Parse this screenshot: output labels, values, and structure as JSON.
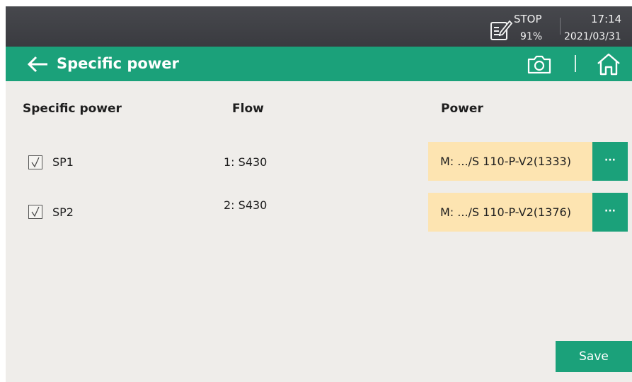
{
  "status_bar": {
    "state": "STOP",
    "percent": "91%",
    "time": "17:14",
    "date": "2021/03/31",
    "doc_icon": "document-edit-icon"
  },
  "header": {
    "title": "Specific power",
    "back_icon": "arrow-left-icon",
    "camera_icon": "camera-icon",
    "home_icon": "home-icon"
  },
  "columns": {
    "specific_power": "Specific power",
    "flow": "Flow",
    "power": "Power"
  },
  "rows": [
    {
      "checked": true,
      "label": "SP1",
      "flow": "1: S430",
      "power": "M: .../S 110-P-V2(1333)",
      "more": "···"
    },
    {
      "checked": true,
      "label": "SP2",
      "flow": "2: S430",
      "power": "M: .../S 110-P-V2(1376)",
      "more": "···"
    }
  ],
  "footer": {
    "save_label": "Save"
  },
  "colors": {
    "accent": "#1ba17a",
    "statusbar": "#404146",
    "background": "#efedea",
    "field": "#fde4b1"
  }
}
